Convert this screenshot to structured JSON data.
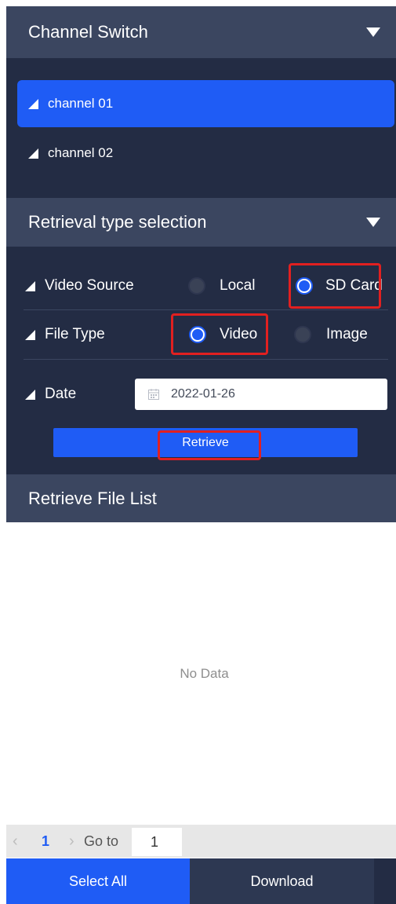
{
  "channel_switch": {
    "title": "Channel Switch",
    "channels": [
      {
        "label": "channel 01",
        "selected": true
      },
      {
        "label": "channel 02",
        "selected": false
      }
    ]
  },
  "retrieval": {
    "title": "Retrieval type selection",
    "video_source": {
      "label": "Video Source",
      "options": [
        "Local",
        "SD Card"
      ],
      "selected": "SD Card"
    },
    "file_type": {
      "label": "File Type",
      "options": [
        "Video",
        "Image"
      ],
      "selected": "Video"
    },
    "date": {
      "label": "Date",
      "value": "2022-01-26"
    },
    "retrieve_label": "Retrieve"
  },
  "file_list": {
    "title": "Retrieve File List",
    "empty_text": "No Data"
  },
  "pagination": {
    "current_page": "1",
    "go_to_label": "Go to",
    "go_to_value": "1"
  },
  "actions": {
    "select_all_label": "Select All",
    "download_label": "Download"
  },
  "colors": {
    "accent": "#1f5cf5",
    "panel": "#232c44",
    "header": "#3b4660",
    "highlight_box": "#e12020"
  }
}
